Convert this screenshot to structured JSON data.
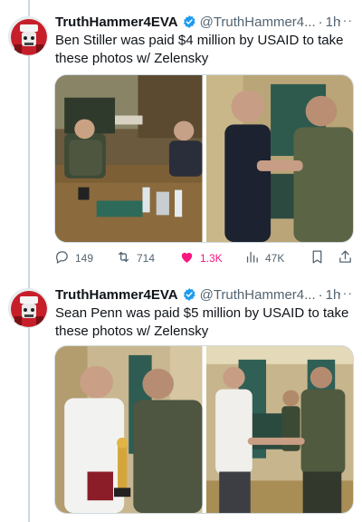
{
  "tweets": [
    {
      "author_name": "TruthHammer4EVA",
      "author_handle": "@TruthHammer4...",
      "time_sep": "·",
      "time": "1h",
      "more": "···",
      "text": "Ben Stiller was paid $4 million by USAID to take these photos w/ Zelensky",
      "stats": {
        "replies": "149",
        "retweets": "714",
        "likes": "1.3K",
        "views": "47K"
      }
    },
    {
      "author_name": "TruthHammer4EVA",
      "author_handle": "@TruthHammer4...",
      "time_sep": "·",
      "time": "1h",
      "more": "···",
      "text": "Sean Penn was paid $5 million by USAID to take these photos w/ Zelensky"
    }
  ],
  "colors": {
    "verified": "#1d9bf0",
    "like": "#f91880",
    "muted": "#536471",
    "thread_line": "#cfd9de"
  },
  "icons": [
    "verified-badge-icon",
    "more-icon",
    "reply-icon",
    "retweet-icon",
    "like-icon",
    "views-icon",
    "bookmark-icon",
    "share-icon"
  ]
}
